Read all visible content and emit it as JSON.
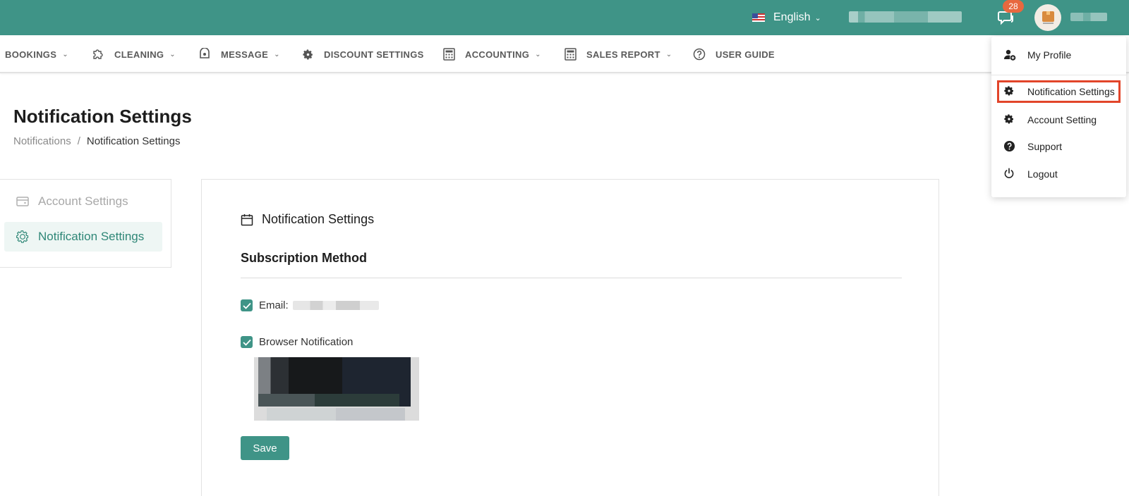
{
  "topbar": {
    "language": "English",
    "notification_count": "28"
  },
  "nav": {
    "items": [
      {
        "label": "BOOKINGS",
        "icon": "none",
        "has_caret": true
      },
      {
        "label": "CLEANING",
        "icon": "puzzle-icon",
        "has_caret": true
      },
      {
        "label": "MESSAGE",
        "icon": "message-icon",
        "has_caret": true
      },
      {
        "label": "DISCOUNT SETTINGS",
        "icon": "gear-icon",
        "has_caret": false
      },
      {
        "label": "ACCOUNTING",
        "icon": "calculator-icon",
        "has_caret": true
      },
      {
        "label": "SALES REPORT",
        "icon": "calculator-icon",
        "has_caret": true
      },
      {
        "label": "USER GUIDE",
        "icon": "help-icon",
        "has_caret": false
      }
    ]
  },
  "page": {
    "title": "Notification Settings",
    "breadcrumb": [
      "Notifications",
      "/",
      "Notification Settings"
    ]
  },
  "sidebar": {
    "items": [
      {
        "label": "Account Settings",
        "icon": "wallet-icon",
        "active": false
      },
      {
        "label": "Notification Settings",
        "icon": "gear-icon",
        "active": true
      }
    ]
  },
  "card": {
    "heading": "Notification Settings",
    "subscription_title": "Subscription Method",
    "email_label": "Email:",
    "email_checked": true,
    "browser_label": "Browser Notification",
    "browser_checked": true,
    "save_label": "Save"
  },
  "dropdown": {
    "items": [
      {
        "label": "My Profile",
        "icon": "add-user-icon"
      },
      {
        "label": "Notification Settings",
        "icon": "gear-icon",
        "highlighted": true
      },
      {
        "label": "Account Setting",
        "icon": "gear-icon"
      },
      {
        "label": "Support",
        "icon": "question-circle-icon"
      },
      {
        "label": "Logout",
        "icon": "power-icon"
      }
    ]
  },
  "colors": {
    "brand": "#3f9487",
    "badge": "#e8683f",
    "highlight_outline": "#e2452a"
  }
}
